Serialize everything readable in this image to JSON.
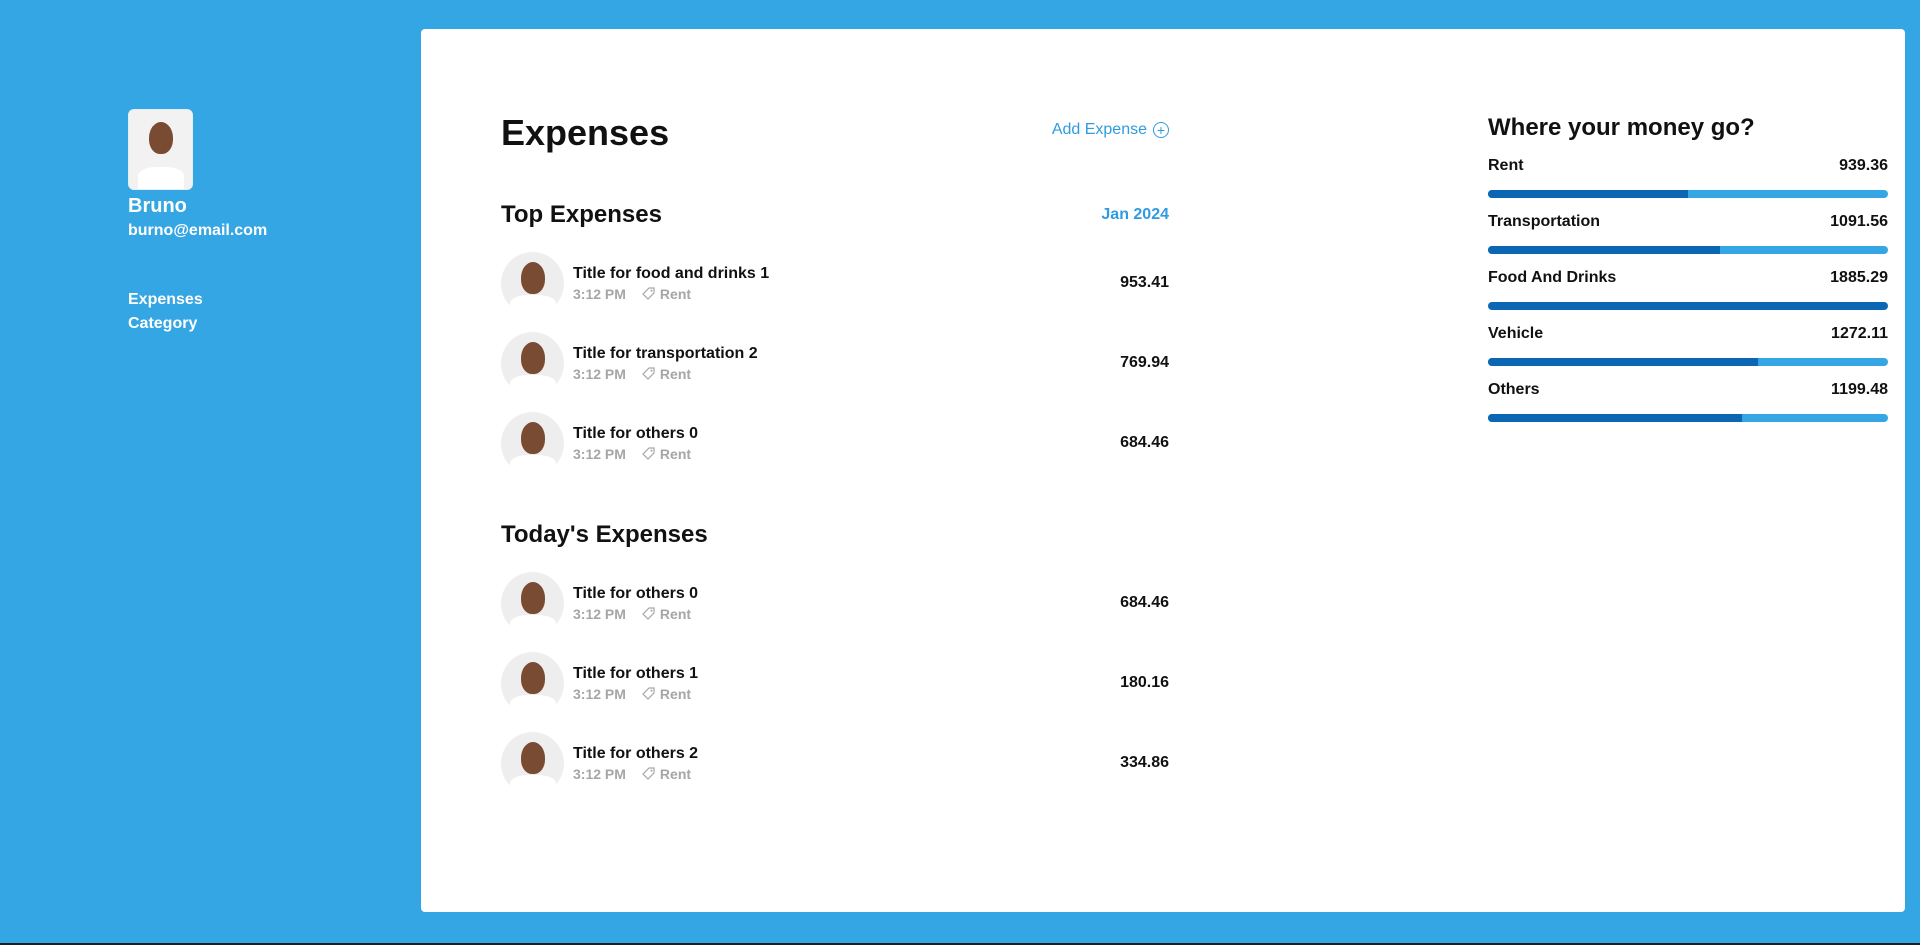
{
  "user": {
    "name": "Bruno",
    "email": "burno@email.com"
  },
  "nav": {
    "items": [
      "Expenses",
      "Category"
    ]
  },
  "header": {
    "title": "Expenses",
    "add_label": "Add Expense"
  },
  "top_expenses": {
    "title": "Top Expenses",
    "month": "Jan 2024",
    "items": [
      {
        "title": "Title for food and drinks 1",
        "time": "3:12 PM",
        "tag": "Rent",
        "amount": "953.41"
      },
      {
        "title": "Title for transportation 2",
        "time": "3:12 PM",
        "tag": "Rent",
        "amount": "769.94"
      },
      {
        "title": "Title for others 0",
        "time": "3:12 PM",
        "tag": "Rent",
        "amount": "684.46"
      }
    ]
  },
  "today_expenses": {
    "title": "Today's Expenses",
    "items": [
      {
        "title": "Title for others 0",
        "time": "3:12 PM",
        "tag": "Rent",
        "amount": "684.46"
      },
      {
        "title": "Title for others 1",
        "time": "3:12 PM",
        "tag": "Rent",
        "amount": "180.16"
      },
      {
        "title": "Title for others 2",
        "time": "3:12 PM",
        "tag": "Rent",
        "amount": "334.86"
      }
    ]
  },
  "breakdown": {
    "title": "Where your money go?",
    "categories": [
      {
        "name": "Rent",
        "amount": "939.36",
        "fraction": 0.5
      },
      {
        "name": "Transportation",
        "amount": "1091.56",
        "fraction": 0.58
      },
      {
        "name": "Food And Drinks",
        "amount": "1885.29",
        "fraction": 1.0
      },
      {
        "name": "Vehicle",
        "amount": "1272.11",
        "fraction": 0.675
      },
      {
        "name": "Others",
        "amount": "1199.48",
        "fraction": 0.635
      }
    ]
  },
  "colors": {
    "background": "#34a6e3",
    "accent": "#2f9be0",
    "bar_fill": "#0b66b3",
    "bar_track": "#34a6e3"
  },
  "icons": {
    "add": "plus-circle-icon",
    "tag": "tag-icon"
  }
}
